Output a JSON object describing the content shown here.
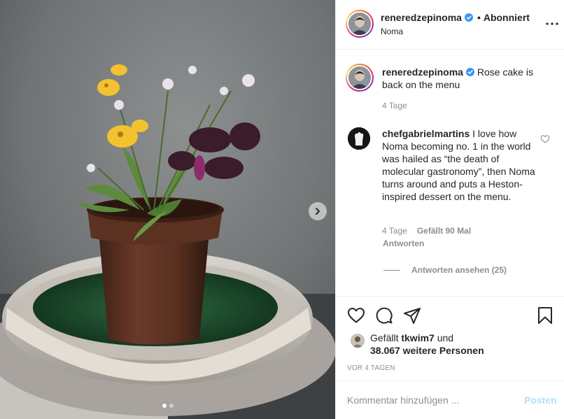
{
  "post": {
    "author": {
      "username": "reneredzepinoma",
      "verified": true,
      "follow_status": "Abonniert",
      "location": "Noma"
    },
    "caption": {
      "username": "reneredzepinoma",
      "text": "Rose cake is back on the menu",
      "time": "4 Tage"
    },
    "comments": [
      {
        "username": "chefgabrielmartins",
        "text": "I love how Noma becoming no. 1 in the world was hailed as “the death of molecular gastronomy”, then Noma turns around and puts a Heston-inspired dessert on the menu.",
        "time": "4 Tage",
        "likes": "Gefällt 90 Mal",
        "reply_label": "Antworten",
        "view_replies_label": "Antworten ansehen (25)"
      }
    ],
    "likes": {
      "prefix": "Gefällt",
      "first_liker": "tkwim7",
      "conjunction": "und",
      "others": "38.067 weitere Personen"
    },
    "date": "VOR 4 TAGEN",
    "comment_input": {
      "placeholder": "Kommentar hinzufügen ...",
      "submit_label": "Posten"
    },
    "carousel": {
      "slide_count": 2,
      "active_index": 0
    }
  },
  "colors": {
    "accent_disabled": "#b2dffc",
    "verified": "#3897f0",
    "secondary_text": "#8e8e8e",
    "primary_text": "#262626",
    "divider": "#efefef"
  },
  "icons": [
    "verified-badge-icon",
    "more-options-icon",
    "heart-icon",
    "comment-icon",
    "share-icon",
    "bookmark-icon",
    "chevron-right-icon",
    "small-heart-icon"
  ]
}
